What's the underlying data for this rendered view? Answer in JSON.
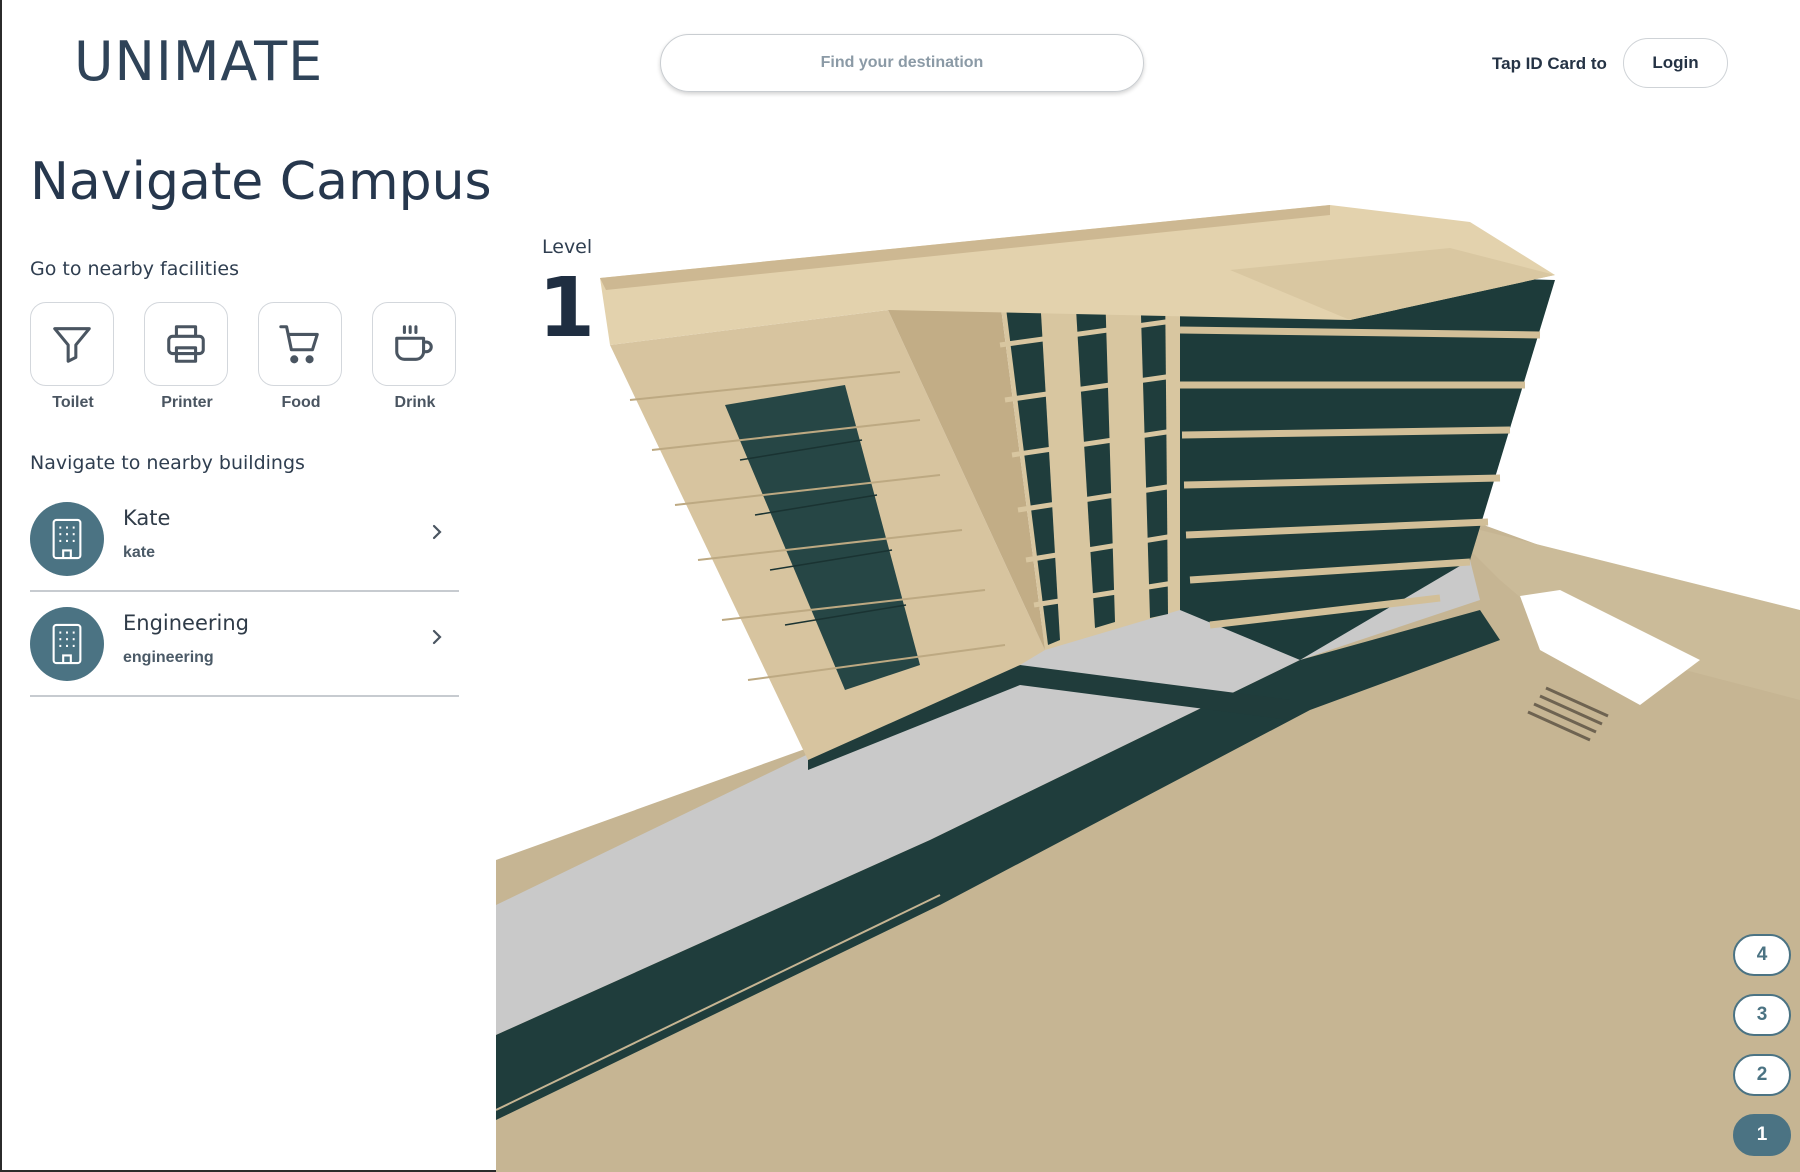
{
  "app": {
    "logo": "UNIMATE"
  },
  "header": {
    "search_placeholder": "Find your destination",
    "tap_text": "Tap ID Card to",
    "login_label": "Login"
  },
  "sidebar": {
    "title": "Navigate Campus",
    "facilities_heading": "Go to nearby facilities",
    "facilities": [
      {
        "label": "Toilet",
        "icon": "filter-icon"
      },
      {
        "label": "Printer",
        "icon": "printer-icon"
      },
      {
        "label": "Food",
        "icon": "cart-icon"
      },
      {
        "label": "Drink",
        "icon": "coffee-cup-icon"
      }
    ],
    "buildings_heading": "Navigate to nearby buildings",
    "buildings": [
      {
        "name": "Kate",
        "id": "kate",
        "icon": "building-icon"
      },
      {
        "name": "Engineering",
        "id": "engineering",
        "icon": "building-icon"
      }
    ]
  },
  "map": {
    "level_label": "Level",
    "current_level": "1",
    "levels": [
      "4",
      "3",
      "2",
      "1"
    ],
    "active_level": "1"
  },
  "colors": {
    "accent": "#4b7383",
    "text_dark": "#26374d",
    "building_beige": "#cdb892",
    "glass": "#1f3d3c",
    "path_grey": "#c9c9c9"
  }
}
